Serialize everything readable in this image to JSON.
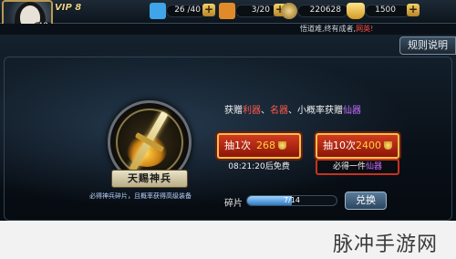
{
  "player": {
    "vip_label": "VIP 8",
    "level": "48"
  },
  "resources": [
    {
      "icon": "stamina-icon",
      "value": "26 /40",
      "color": "#3fa4e8"
    },
    {
      "icon": "energy-icon",
      "value": "3/20",
      "color": "#e08a2a"
    },
    {
      "icon": "coin-icon",
      "value": "220628",
      "color": "#c9a44a"
    },
    {
      "icon": "gold-ingot-icon",
      "value": "1500",
      "color": "#f2c445"
    }
  ],
  "notice": {
    "text": "悟道难,终有成者,",
    "highlight": "网英!"
  },
  "rules_button": "规则说明",
  "emblem": {
    "banner": "天赐神兵",
    "caption": "必得神兵碎片，且概率获得高级装备"
  },
  "gift_line": {
    "prefix": "获赠",
    "item1": "利器",
    "sep1": "、",
    "item2": "名器",
    "mid": "、小概率获赠",
    "item3": "仙器"
  },
  "draw_once": {
    "label": "抽1次",
    "cost": "268",
    "timer": "08:21:20后免费"
  },
  "draw_ten": {
    "label": "抽10次",
    "cost": "2400",
    "guarantee_prefix": "必得一件",
    "guarantee_item": "仙器"
  },
  "shards": {
    "label": "碎片",
    "value": "7/14",
    "progress": 0.5,
    "exchange_button": "兑换"
  },
  "watermark": "脉冲手游网",
  "colors": {
    "accent_gold": "#f2c04a",
    "draw_red": "#d23a20",
    "rare_purple": "#c66cff",
    "highlight_red": "#ff5a4a"
  }
}
